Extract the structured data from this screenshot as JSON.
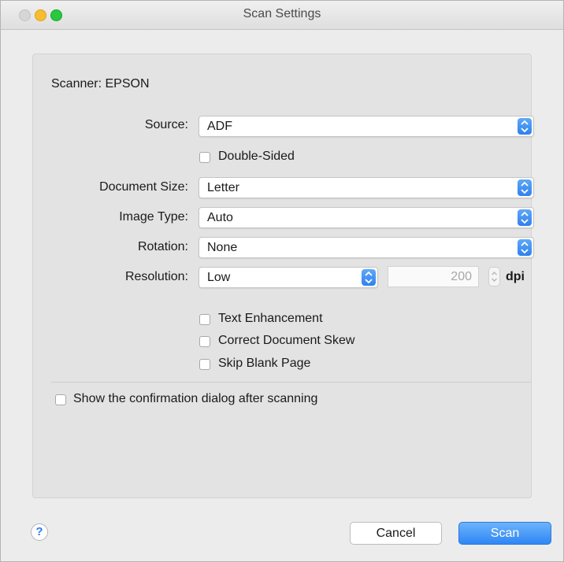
{
  "window": {
    "title": "Scan Settings"
  },
  "scanner": {
    "label": "Scanner: EPSON"
  },
  "source": {
    "label": "Source:",
    "value": "ADF"
  },
  "double_sided": {
    "label": "Double-Sided",
    "checked": false
  },
  "document_size": {
    "label": "Document Size:",
    "value": "Letter"
  },
  "image_type": {
    "label": "Image Type:",
    "value": "Auto"
  },
  "rotation": {
    "label": "Rotation:",
    "value": "None"
  },
  "resolution": {
    "label": "Resolution:",
    "value": "Low",
    "dpi_value": "200",
    "dpi_unit": "dpi"
  },
  "options": {
    "text_enhancement": {
      "label": "Text Enhancement",
      "checked": false
    },
    "correct_skew": {
      "label": "Correct Document Skew",
      "checked": false
    },
    "skip_blank": {
      "label": "Skip Blank Page",
      "checked": false
    }
  },
  "confirmation": {
    "label": "Show the confirmation dialog after scanning",
    "checked": false
  },
  "footer": {
    "help_label": "?",
    "cancel_label": "Cancel",
    "scan_label": "Scan"
  },
  "colors": {
    "accent": "#2f86f5",
    "panel": "#e3e3e3"
  }
}
